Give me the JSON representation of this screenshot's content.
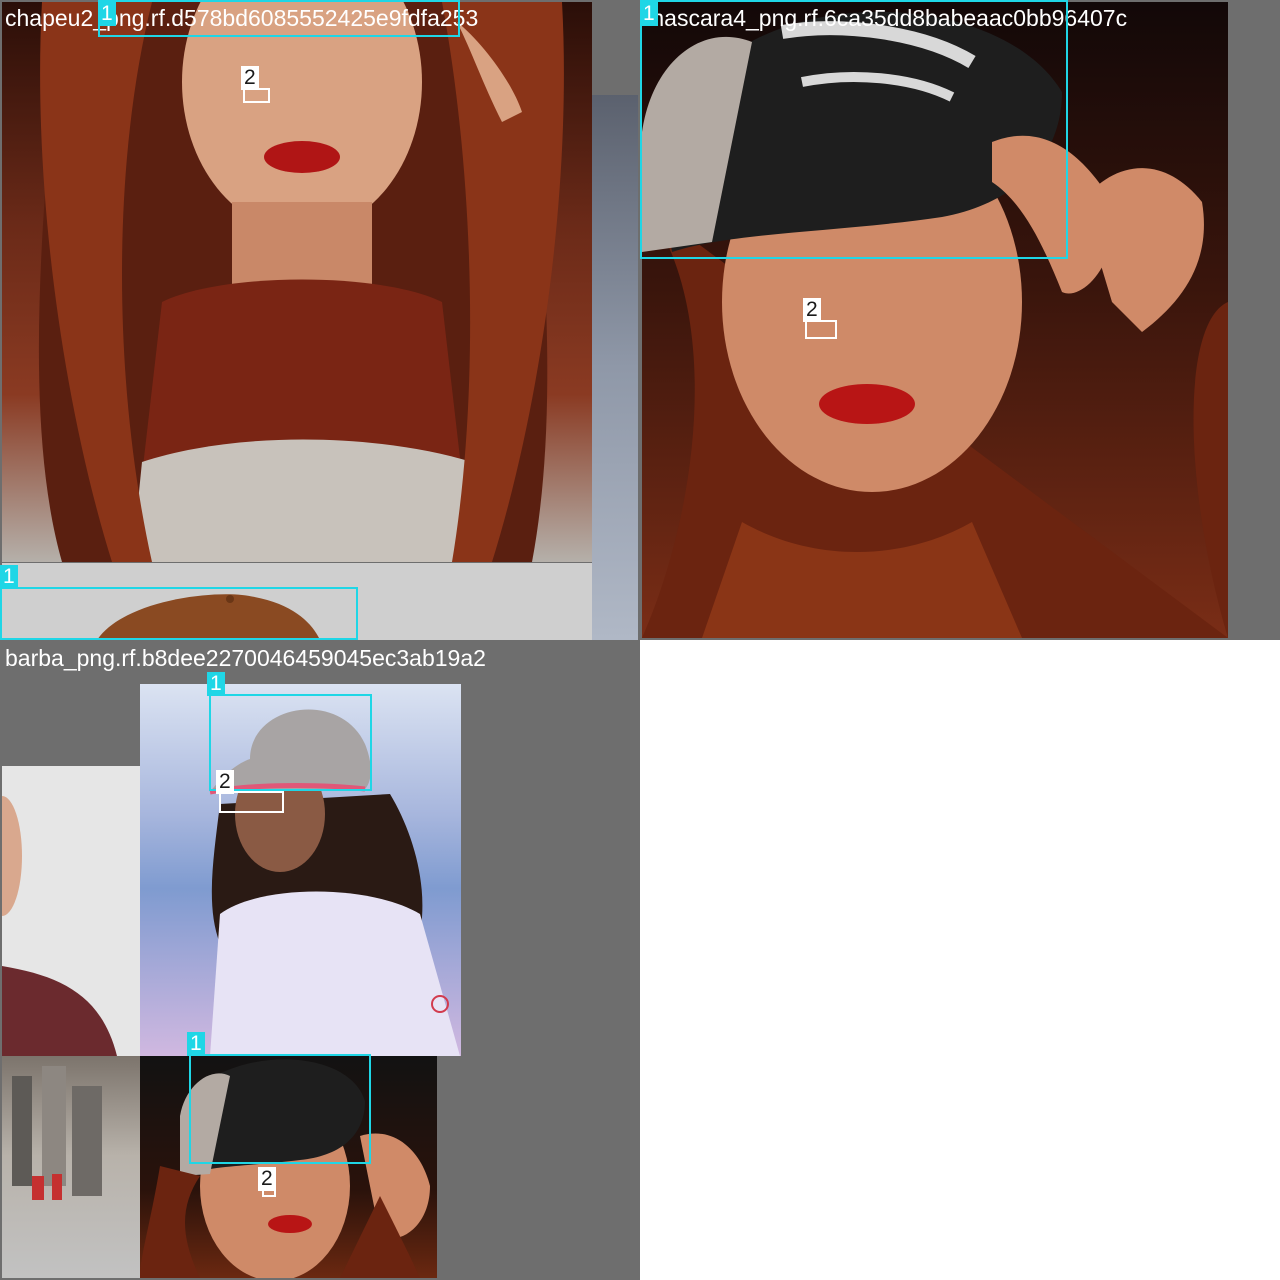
{
  "mosaic": {
    "tiles": [
      {
        "filename": "chapeu2_png.rf.d578bd6085552425e9fdfa253",
        "labels": [
          "1",
          "2",
          "1"
        ]
      },
      {
        "filename": "mascara4_png.rf.6ca35dd8babeaac0bb96407c",
        "labels": [
          "1",
          "2"
        ]
      },
      {
        "filename": "barba_png.rf.b8dee2270046459045ec3ab19a2",
        "labels": [
          "1",
          "2",
          "1",
          "2"
        ]
      }
    ]
  },
  "colors": {
    "box_cyan": "#1fd6e6",
    "box_white": "#ffffff",
    "letterbox_gray": "#6e6e6e",
    "empty_cell": "#ffffff"
  }
}
